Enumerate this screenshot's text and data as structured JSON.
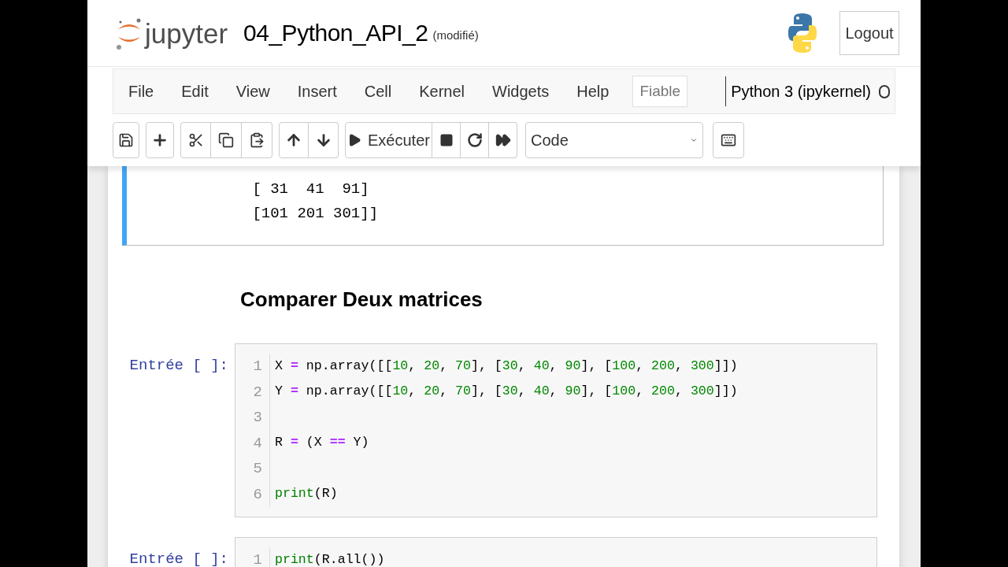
{
  "header": {
    "logo_text": "jupyter",
    "notebook_title": "04_Python_API_2",
    "save_status": "(modifié)",
    "logout": "Logout"
  },
  "menu": [
    "File",
    "Edit",
    "View",
    "Insert",
    "Cell",
    "Kernel",
    "Widgets",
    "Help"
  ],
  "trust_indicator": "Fiable",
  "kernel": {
    "name": "Python 3 (ipykernel)",
    "busy": false
  },
  "toolbar": {
    "run_label": "Exécuter",
    "cell_type": "Code"
  },
  "cells": [
    {
      "kind": "output",
      "lines": [
        " [ 31  41  91]",
        " [101 201 301]]"
      ]
    },
    {
      "kind": "markdown",
      "heading": "Comparer Deux matrices"
    },
    {
      "kind": "code",
      "prompt": "Entrée [ ]:",
      "lines": [
        {
          "number": "1",
          "tokens": [
            {
              "kind": "plain",
              "text": "X "
            },
            {
              "kind": "op",
              "text": "="
            },
            {
              "kind": "plain",
              "text": " np.array([["
            },
            {
              "kind": "num",
              "text": "10"
            },
            {
              "kind": "plain",
              "text": ", "
            },
            {
              "kind": "num",
              "text": "20"
            },
            {
              "kind": "plain",
              "text": ", "
            },
            {
              "kind": "num",
              "text": "70"
            },
            {
              "kind": "plain",
              "text": "], ["
            },
            {
              "kind": "num",
              "text": "30"
            },
            {
              "kind": "plain",
              "text": ", "
            },
            {
              "kind": "num",
              "text": "40"
            },
            {
              "kind": "plain",
              "text": ", "
            },
            {
              "kind": "num",
              "text": "90"
            },
            {
              "kind": "plain",
              "text": "], ["
            },
            {
              "kind": "num",
              "text": "100"
            },
            {
              "kind": "plain",
              "text": ", "
            },
            {
              "kind": "num",
              "text": "200"
            },
            {
              "kind": "plain",
              "text": ", "
            },
            {
              "kind": "num",
              "text": "300"
            },
            {
              "kind": "plain",
              "text": "]])"
            }
          ]
        },
        {
          "number": "2",
          "tokens": [
            {
              "kind": "plain",
              "text": "Y "
            },
            {
              "kind": "op",
              "text": "="
            },
            {
              "kind": "plain",
              "text": " np.array([["
            },
            {
              "kind": "num",
              "text": "10"
            },
            {
              "kind": "plain",
              "text": ", "
            },
            {
              "kind": "num",
              "text": "20"
            },
            {
              "kind": "plain",
              "text": ", "
            },
            {
              "kind": "num",
              "text": "70"
            },
            {
              "kind": "plain",
              "text": "], ["
            },
            {
              "kind": "num",
              "text": "30"
            },
            {
              "kind": "plain",
              "text": ", "
            },
            {
              "kind": "num",
              "text": "40"
            },
            {
              "kind": "plain",
              "text": ", "
            },
            {
              "kind": "num",
              "text": "90"
            },
            {
              "kind": "plain",
              "text": "], ["
            },
            {
              "kind": "num",
              "text": "100"
            },
            {
              "kind": "plain",
              "text": ", "
            },
            {
              "kind": "num",
              "text": "200"
            },
            {
              "kind": "plain",
              "text": ", "
            },
            {
              "kind": "num",
              "text": "300"
            },
            {
              "kind": "plain",
              "text": "]])"
            }
          ]
        },
        {
          "number": "3"
        },
        {
          "number": "4",
          "tokens": [
            {
              "kind": "plain",
              "text": "R "
            },
            {
              "kind": "op",
              "text": "="
            },
            {
              "kind": "plain",
              "text": " (X "
            },
            {
              "kind": "op",
              "text": "=="
            },
            {
              "kind": "plain",
              "text": " Y)"
            }
          ]
        },
        {
          "number": "5"
        },
        {
          "number": "6",
          "tokens": [
            {
              "kind": "builtin",
              "text": "print"
            },
            {
              "kind": "plain",
              "text": "(R)"
            }
          ]
        }
      ]
    },
    {
      "kind": "code",
      "prompt": "Entrée [ ]:",
      "lines": [
        {
          "number": "1",
          "tokens": [
            {
              "kind": "builtin",
              "text": "print"
            },
            {
              "kind": "plain",
              "text": "(R.all())"
            }
          ]
        }
      ]
    }
  ]
}
